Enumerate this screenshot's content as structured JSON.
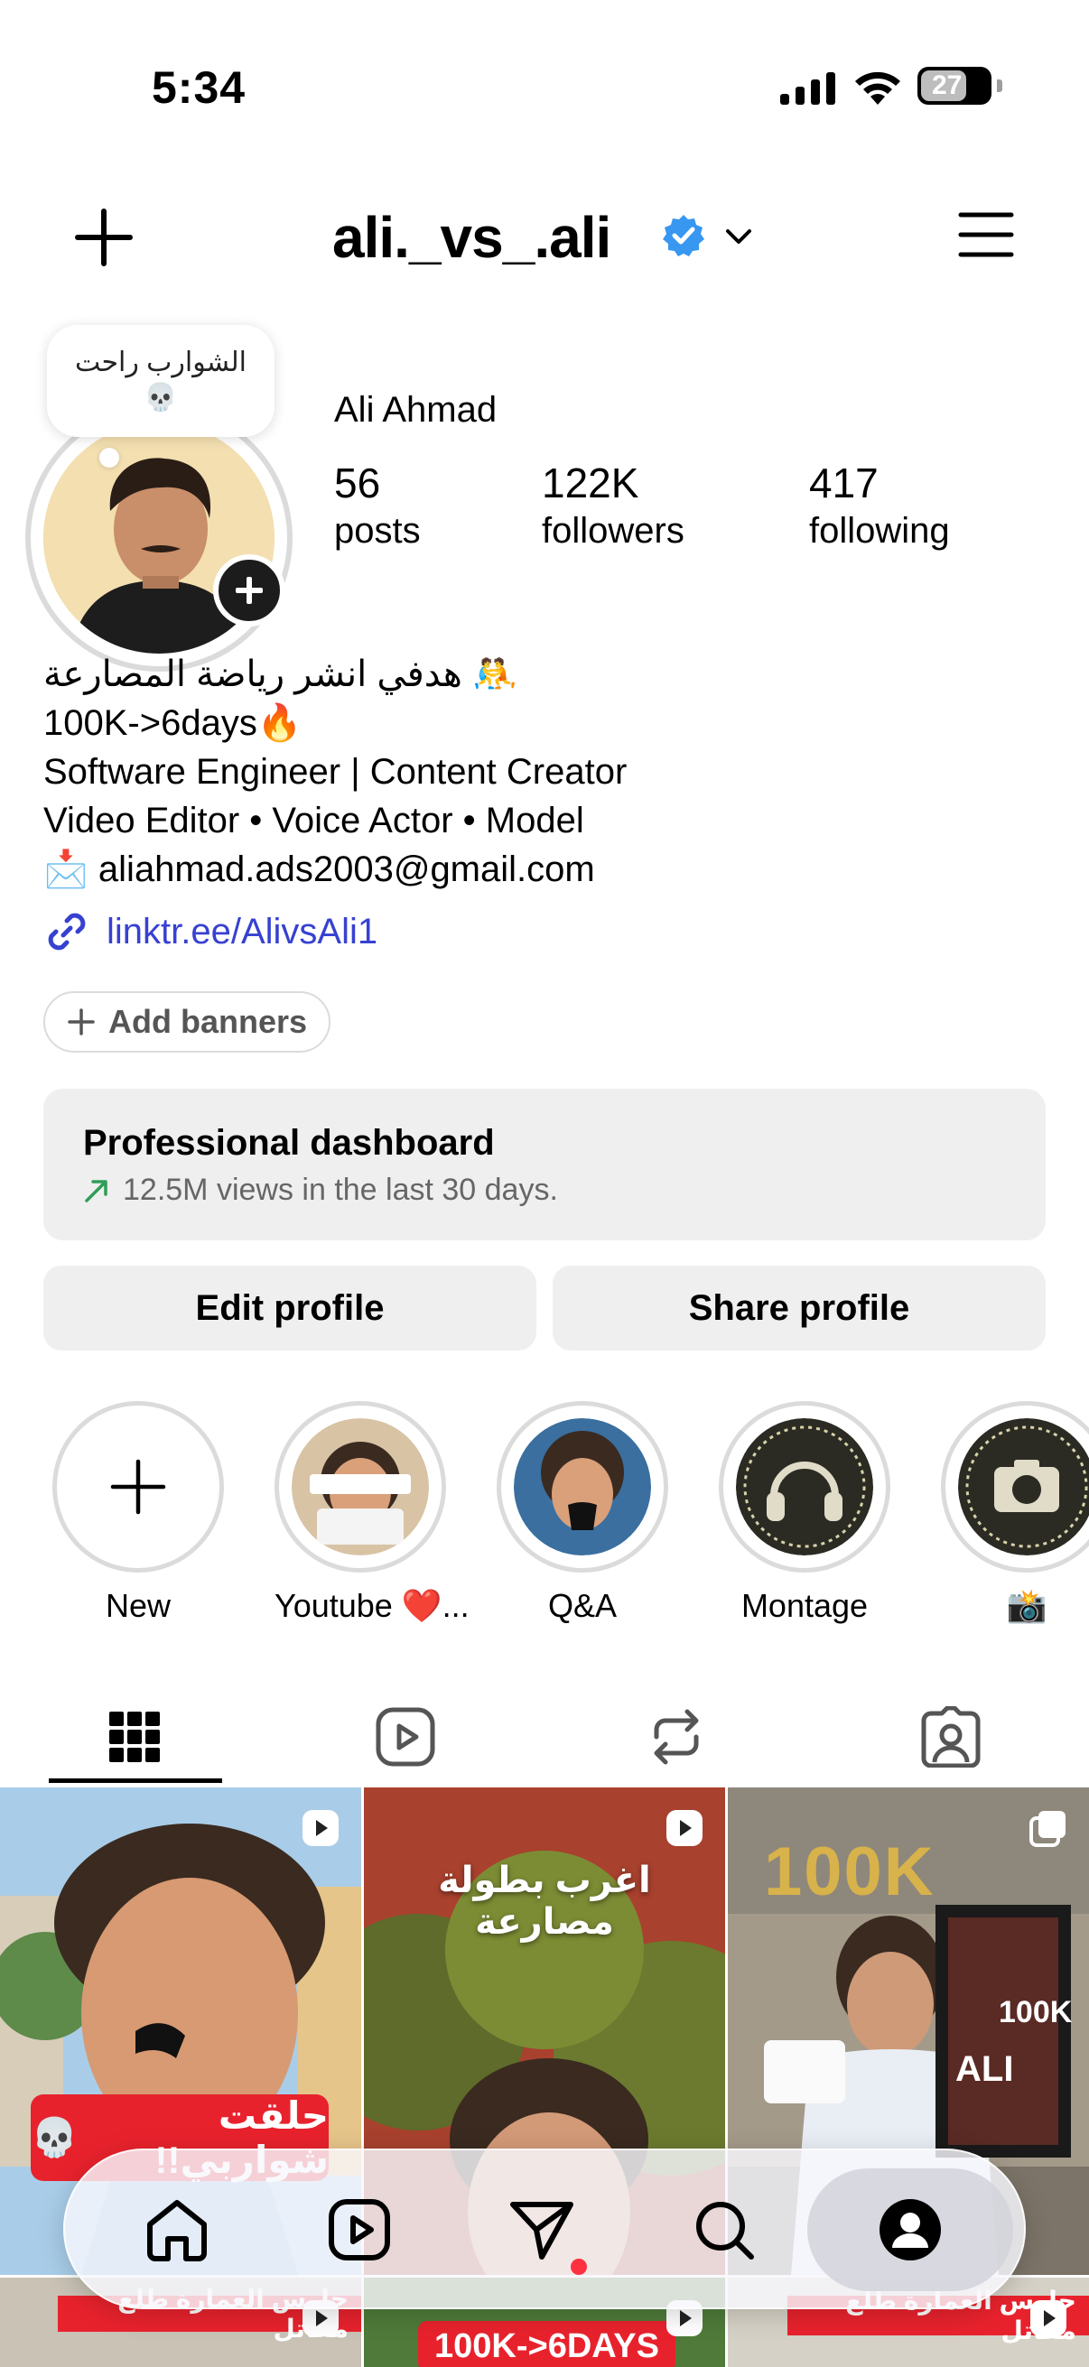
{
  "status_bar": {
    "time": "5:34",
    "battery": "27"
  },
  "header": {
    "username": "ali._vs_.ali"
  },
  "note": {
    "text": "الشوارب راحت",
    "emoji": "💀"
  },
  "profile": {
    "display_name": "Ali Ahmad",
    "stats": [
      {
        "value": "56",
        "label": "posts"
      },
      {
        "value": "122K",
        "label": "followers"
      },
      {
        "value": "417",
        "label": "following"
      }
    ],
    "bio_lines": [
      "🤼 هدفي انشر رياضة المصارعة",
      "100K->6days🔥",
      "Software Engineer | Content Creator",
      "Video Editor • Voice Actor • Model",
      "📩 aliahmad.ads2003@gmail.com"
    ],
    "link": "linktr.ee/AlivsAli1",
    "add_banners": "Add banners"
  },
  "dashboard": {
    "title": "Professional dashboard",
    "subtitle": "12.5M views in the last 30 days."
  },
  "actions": {
    "edit": "Edit profile",
    "share": "Share profile"
  },
  "highlights": [
    {
      "label": "New"
    },
    {
      "label": "Youtube ❤️..."
    },
    {
      "label": "Q&A"
    },
    {
      "label": "Montage"
    },
    {
      "label": "📸"
    }
  ],
  "posts": {
    "p1_caption": "حلقت شواربي!!",
    "p2_caption": "اغرب بطولة مصارعة",
    "p3_sign": "100K",
    "p3_poster_big": "100K",
    "p3_poster_name": "ALI",
    "p4_caption": "حارس العمارة طلع مقاتل",
    "p5_caption": "100K->6DAYS",
    "p6_caption": "حارس العمارة طلع مقاتل"
  },
  "colors": {
    "verified": "#3897f0",
    "link": "#3741d1",
    "notification_dot": "#ff3040",
    "surface": "#efeff0"
  }
}
